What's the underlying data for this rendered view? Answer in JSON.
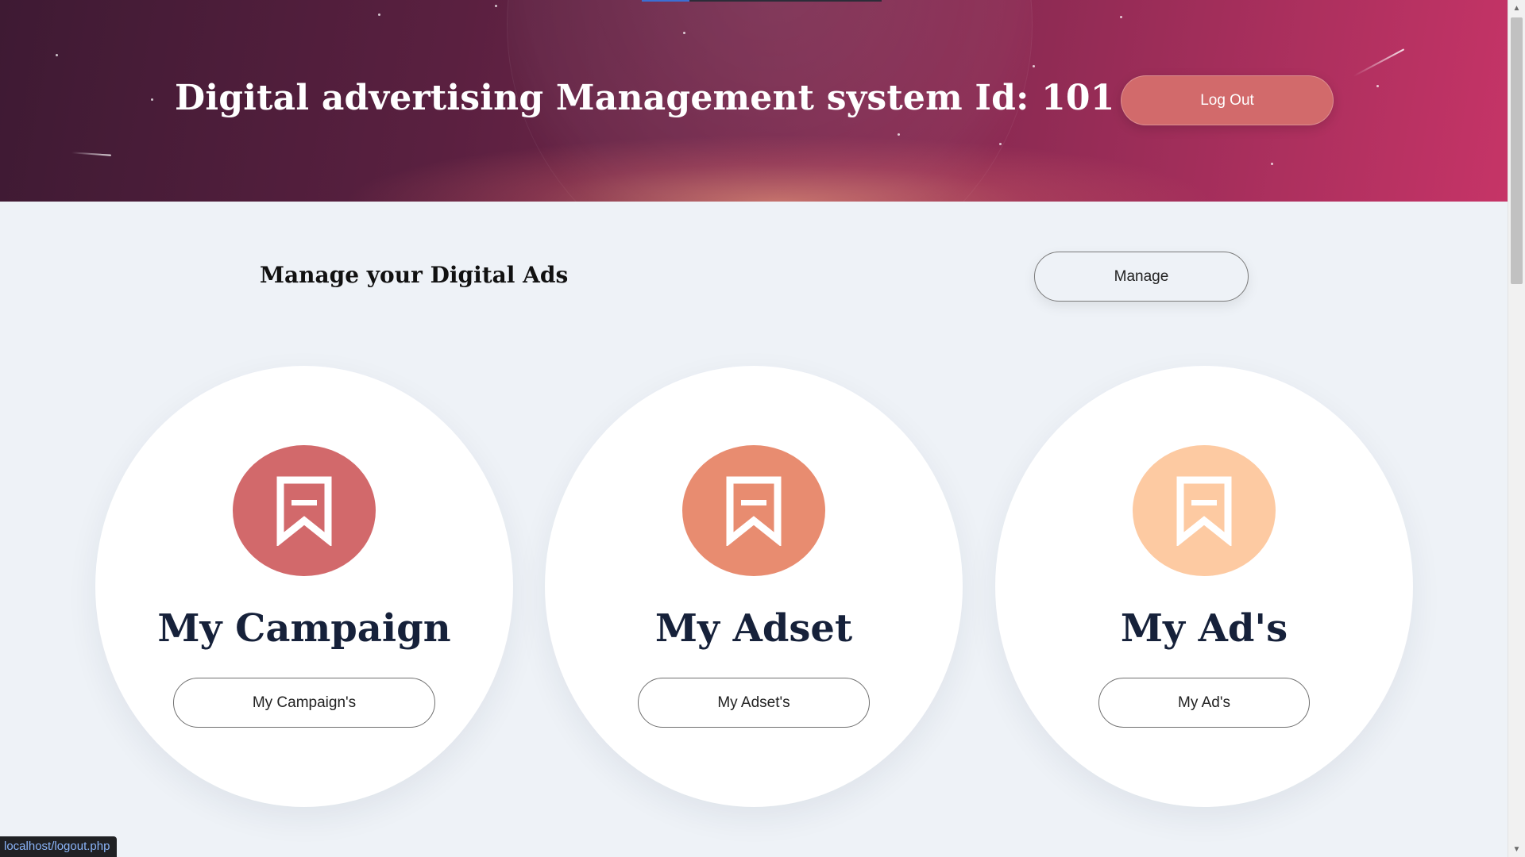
{
  "header": {
    "title": "Digital advertising Management system Id: 101",
    "logout_label": "Log Out"
  },
  "manage": {
    "title": "Manage your Digital Ads",
    "button_label": "Manage"
  },
  "cards": [
    {
      "title": "My Campaign",
      "button_label": "My Campaign's",
      "icon": "bookmark-icon",
      "color": "#d2696b"
    },
    {
      "title": "My Adset",
      "button_label": "My Adset's",
      "icon": "bookmark-icon",
      "color": "#e88c70"
    },
    {
      "title": "My Ad's",
      "button_label": "My Ad's",
      "icon": "bookmark-icon",
      "color": "#fdcaa2"
    }
  ],
  "status_bar": {
    "url": "localhost/logout.php"
  },
  "colors": {
    "header_start": "#3e1a33",
    "header_end": "#c63467",
    "page_background": "#eef2f7",
    "logout_button": "#d26a6b",
    "title_text": "#16213a"
  }
}
